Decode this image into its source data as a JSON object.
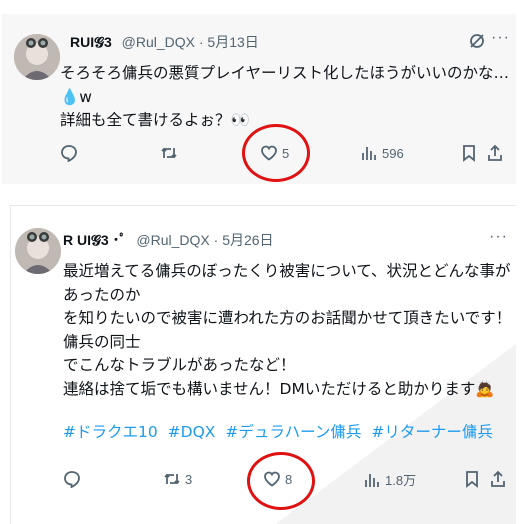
{
  "tweets": [
    {
      "display_name": "RUI𝓖3",
      "handle_date": "@Rul_DQX · 5月13日",
      "lines": [
        "そろそろ傭兵の悪質プレイヤーリスト化したほうがいいのかな…💧w",
        "詳細も全て書けるよぉ？👀"
      ],
      "actions": {
        "reply_count": "",
        "retweet_count": "",
        "like_count": "5",
        "view_count": "596"
      }
    },
    {
      "display_name": "R UI𝓖3 ･ﾟ",
      "handle_date": "@Rul_DQX · 5月26日",
      "lines": [
        "最近増えてる傭兵のぼったくり被害について、状況とどんな事があったのか",
        "を知りたいので被害に遭われた方のお話聞かせて頂きたいです！傭兵の同士",
        "でこんなトラブルがあったなど！",
        "連絡は捨て垢でも構いません！DMいただけると助かります🙇"
      ],
      "hashtags": [
        "#ドラクエ10",
        "#DQX",
        "#デュラハーン傭兵",
        "#リターナー傭兵"
      ],
      "actions": {
        "reply_count": "",
        "retweet_count": "3",
        "like_count": "8",
        "view_count": "1.8万"
      }
    }
  ],
  "colors": {
    "accent": "#1d9bf0",
    "icon": "#536471",
    "highlight": "#e01111"
  },
  "icons": [
    "reply-icon",
    "retweet-icon",
    "like-icon",
    "views-icon",
    "bookmark-icon",
    "share-icon",
    "grok-icon",
    "more-icon"
  ]
}
